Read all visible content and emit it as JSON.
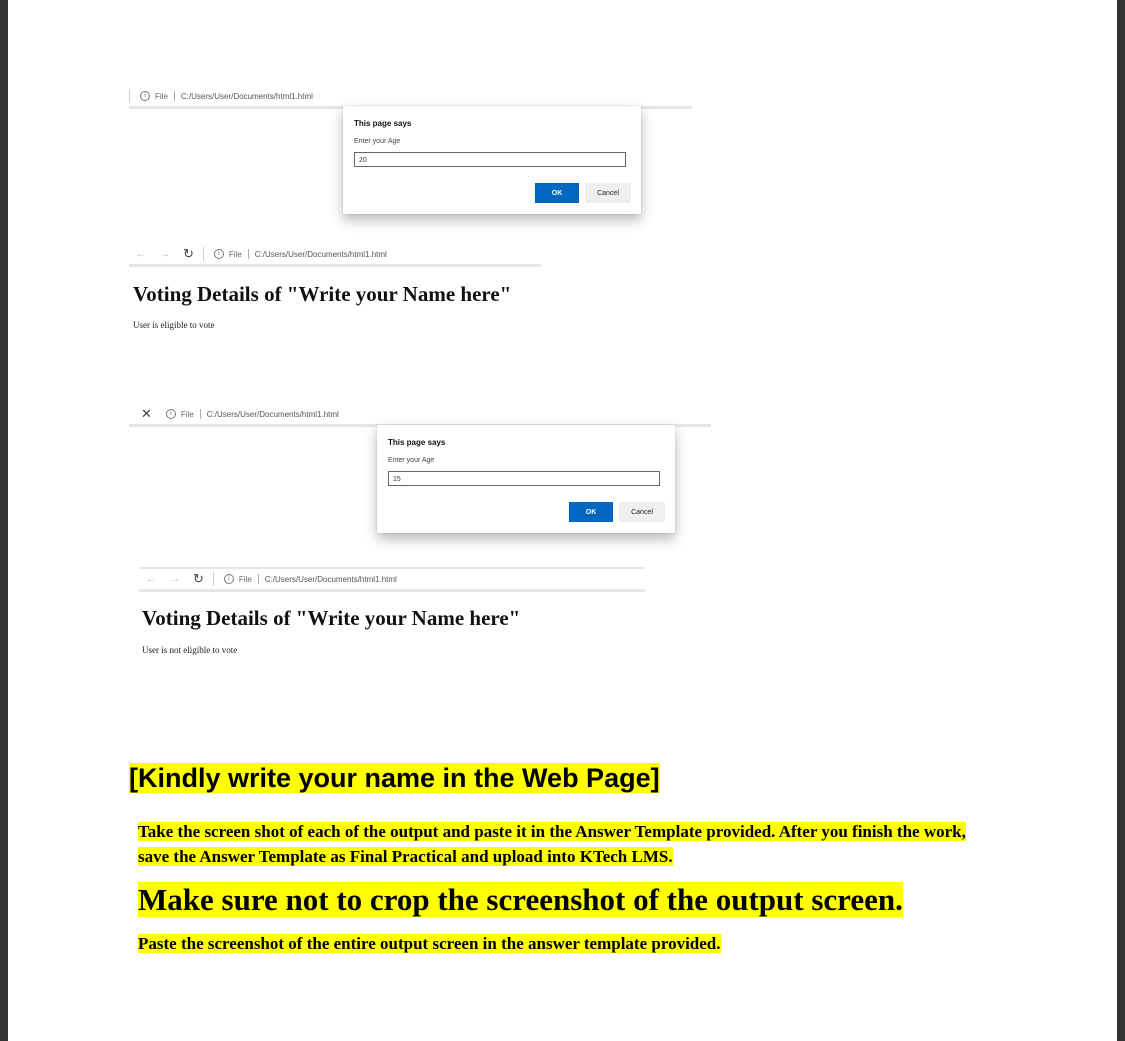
{
  "screenshot1": {
    "address": {
      "file_label": "File",
      "path": "C:/Users/User/Documents/html1.html"
    },
    "dialog": {
      "title": "This page says",
      "prompt": "Enter your Age",
      "value": "20",
      "ok_label": "OK",
      "cancel_label": "Cancel"
    }
  },
  "screenshot2": {
    "address": {
      "file_label": "File",
      "path": "C:/Users/User/Documents/html1.html"
    },
    "heading": "Voting Details of \"Write your Name here\"",
    "status": "User is eligible to vote"
  },
  "screenshot3": {
    "address": {
      "file_label": "File",
      "path": "C:/Users/User/Documents/html1.html"
    },
    "dialog": {
      "title": "This page says",
      "prompt": "Enter your Age",
      "value": "15",
      "ok_label": "OK",
      "cancel_label": "Cancel"
    }
  },
  "screenshot4": {
    "address": {
      "file_label": "File",
      "path": "C:/Users/User/Documents/html1.html"
    },
    "heading": "Voting Details of \"Write your Name here\"",
    "status": "User is not eligible to vote"
  },
  "instructions": {
    "title": "[Kindly write your name in the Web Page]",
    "paragraph": "Take the screen shot of each of the output and paste it in the Answer Template provided. After you finish the work, save the Answer Template as Final Practical and upload into KTech LMS.",
    "emphasis": "Make sure not to crop the screenshot of the output screen.",
    "note": "Paste the screenshot of the entire output screen in the answer template provided."
  },
  "colors": {
    "highlight": "#ffff00",
    "ok_button": "#0067c0",
    "page_bg": "#ffffff",
    "frame_bg": "#333333"
  }
}
